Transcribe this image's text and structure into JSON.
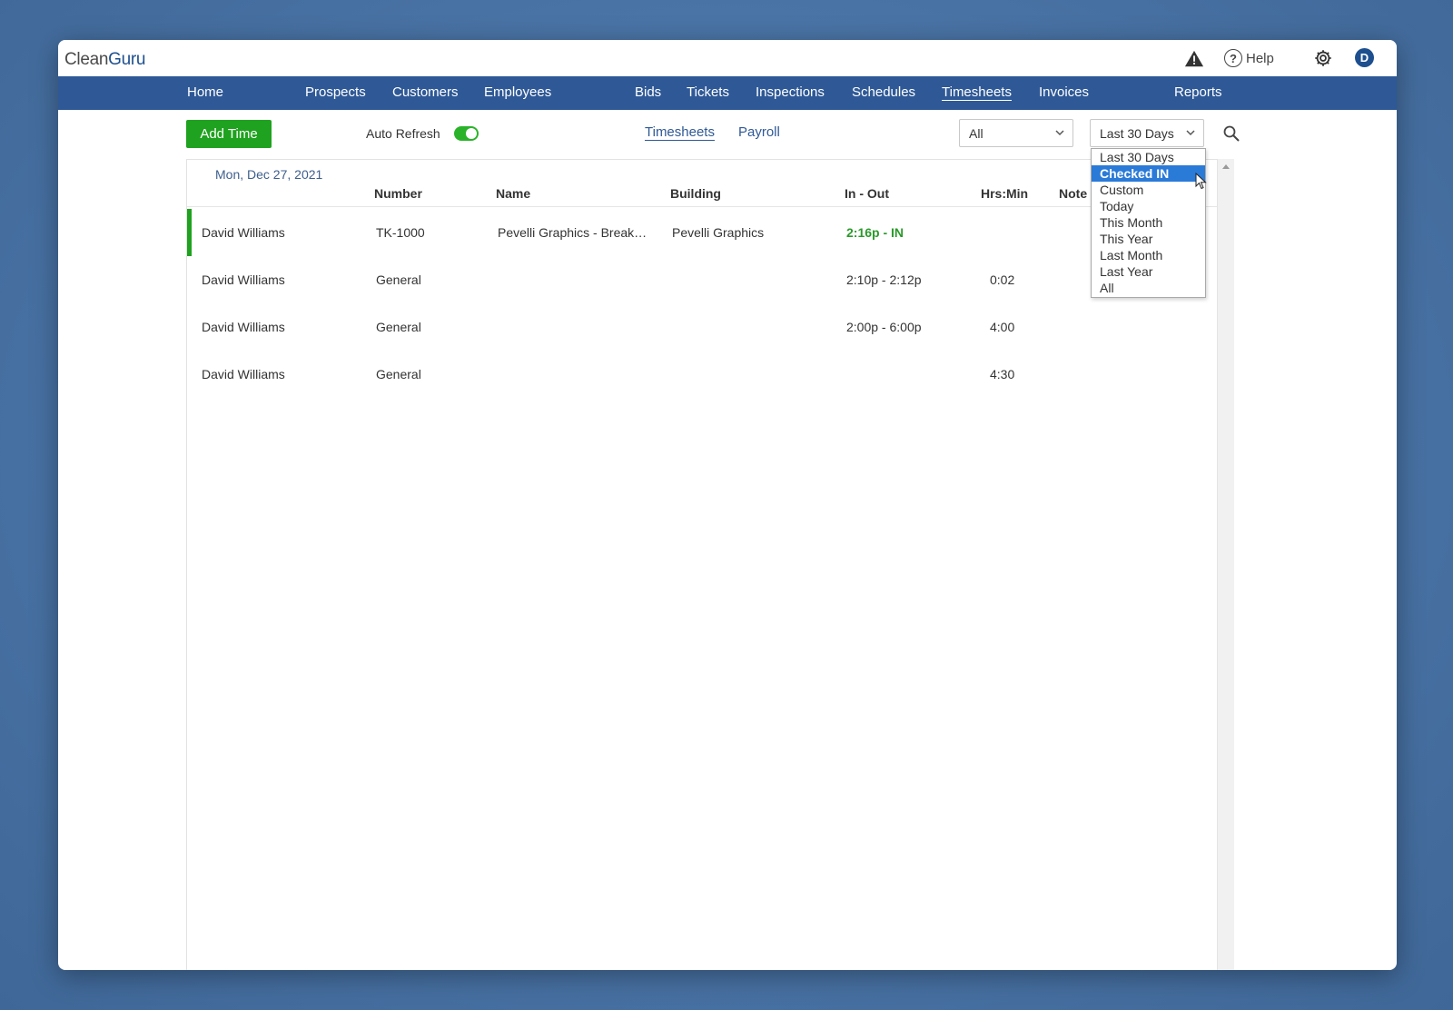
{
  "app": {
    "logo_part1": "Clean",
    "logo_part2": "Guru",
    "help_label": "Help",
    "avatar_initial": "D"
  },
  "nav": {
    "items": [
      "Home",
      "Prospects",
      "Customers",
      "Employees",
      "Bids",
      "Tickets",
      "Inspections",
      "Schedules",
      "Timesheets",
      "Invoices",
      "Reports"
    ],
    "active": "Timesheets"
  },
  "toolbar": {
    "add_time_label": "Add Time",
    "auto_refresh_label": "Auto Refresh",
    "auto_refresh_on": true,
    "tabs": [
      "Timesheets",
      "Payroll"
    ],
    "active_tab": "Timesheets",
    "filter_select_value": "All",
    "range_select_value": "Last 30 Days"
  },
  "range_dropdown": {
    "options": [
      "Last 30 Days",
      "Checked IN",
      "Custom",
      "Today",
      "This Month",
      "This Year",
      "Last Month",
      "Last Year",
      "All"
    ],
    "highlighted": "Checked IN"
  },
  "table": {
    "date_label": "Mon, Dec 27, 2021",
    "columns": [
      "Number",
      "Name",
      "Building",
      "In - Out",
      "Hrs:Min",
      "Note"
    ],
    "rows": [
      {
        "employee": "David Williams",
        "number": "TK-1000",
        "name": "Pevelli Graphics - Break…",
        "building": "Pevelli Graphics",
        "in_out": "2:16p - IN",
        "hrs": "",
        "checked_in": true
      },
      {
        "employee": "David Williams",
        "number": "General",
        "name": "",
        "building": "",
        "in_out": "2:10p - 2:12p",
        "hrs": "0:02",
        "checked_in": false
      },
      {
        "employee": "David Williams",
        "number": "General",
        "name": "",
        "building": "",
        "in_out": "2:00p - 6:00p",
        "hrs": "4:00",
        "checked_in": false
      },
      {
        "employee": "David Williams",
        "number": "General",
        "name": "",
        "building": "",
        "in_out": "",
        "hrs": "4:30",
        "checked_in": false
      }
    ]
  },
  "colors": {
    "nav_bg": "#2f5996",
    "accent_green": "#1fa21f",
    "selection_blue": "#2a7ad8",
    "background_blue": "#4a74a6"
  }
}
